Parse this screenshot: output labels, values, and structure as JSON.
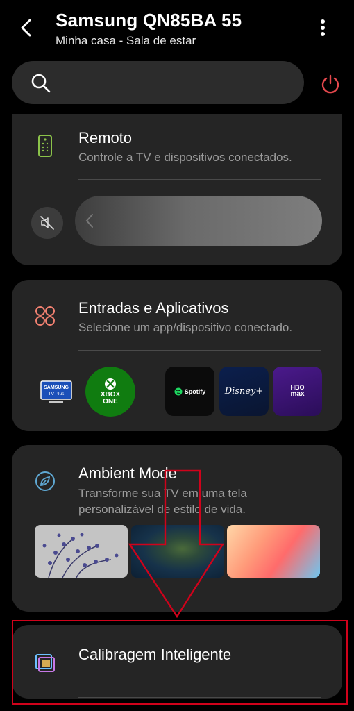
{
  "header": {
    "device_name": "Samsung QN85BA 55",
    "location": "Minha casa - Sala de estar"
  },
  "cards": {
    "remote": {
      "title": "Remoto",
      "description": "Controle a TV e dispositivos conectados."
    },
    "inputs": {
      "title": "Entradas e Aplicativos",
      "description": "Selecione um app/dispositivo conectado.",
      "apps": [
        {
          "name": "Samsung TV Plus",
          "label_top": "SAMSUNG",
          "label_bottom": "TV Plus"
        },
        {
          "name": "Xbox One",
          "label_top": "XBOX",
          "label_bottom": "ONE"
        },
        {
          "name": "Spotify",
          "label": "Spotify"
        },
        {
          "name": "Disney+",
          "label": "Disney+"
        },
        {
          "name": "HBO Max",
          "label_top": "HBO",
          "label_bottom": "max"
        }
      ]
    },
    "ambient": {
      "title": "Ambient Mode",
      "description_line1": "Transforme sua TV em uma tela",
      "description_line2": "personalizável de estilo de vida."
    },
    "calibration": {
      "title": "Calibragem Inteligente"
    }
  },
  "colors": {
    "power_icon": "#e5484d",
    "remote_icon": "#8bc34a",
    "inputs_icon": "#f08070",
    "ambient_icon": "#5fa8d3",
    "annotation": "#d0021b"
  }
}
